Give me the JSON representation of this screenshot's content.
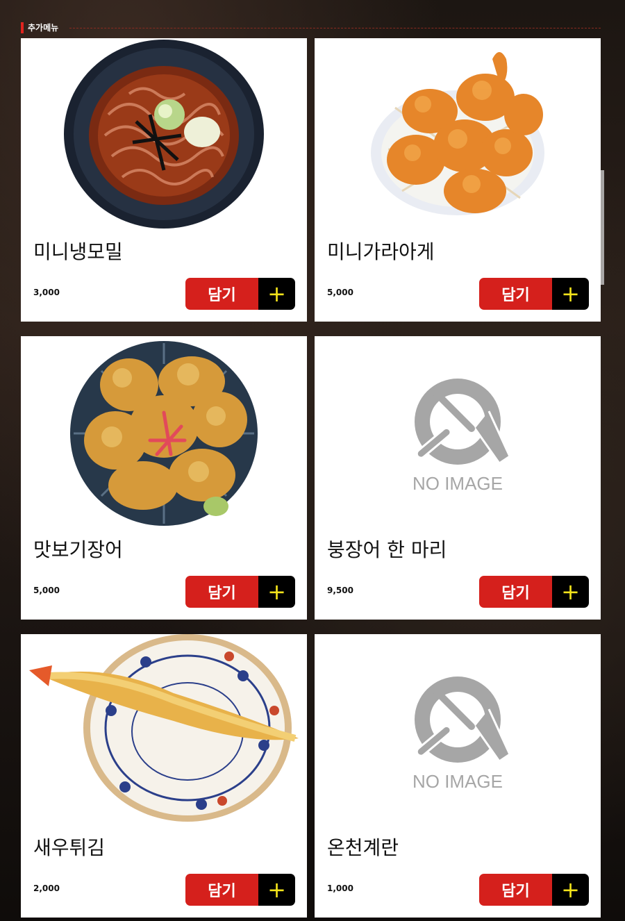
{
  "section": {
    "title": "추가메뉴"
  },
  "cart_button": {
    "label": "담기",
    "plus": "+"
  },
  "items": [
    {
      "name": "미니냉모밀",
      "price": "3,000",
      "image": "cold-soba-bowl"
    },
    {
      "name": "미니가라아게",
      "price": "5,000",
      "image": "karaage-plate"
    },
    {
      "name": "맛보기장어",
      "price": "5,000",
      "image": "fried-eel-plate"
    },
    {
      "name": "붕장어 한 마리",
      "price": "9,500",
      "image": "no-image",
      "placeholder": "NO IMAGE"
    },
    {
      "name": "새우튀김",
      "price": "2,000",
      "image": "shrimp-tempura-plate"
    },
    {
      "name": "온천계란",
      "price": "1,000",
      "image": "no-image",
      "placeholder": "NO IMAGE"
    }
  ],
  "colors": {
    "accent": "#d5201c",
    "plus": "#f3e31b",
    "card_bg": "#ffffff",
    "placeholder": "#a6a6a6"
  }
}
